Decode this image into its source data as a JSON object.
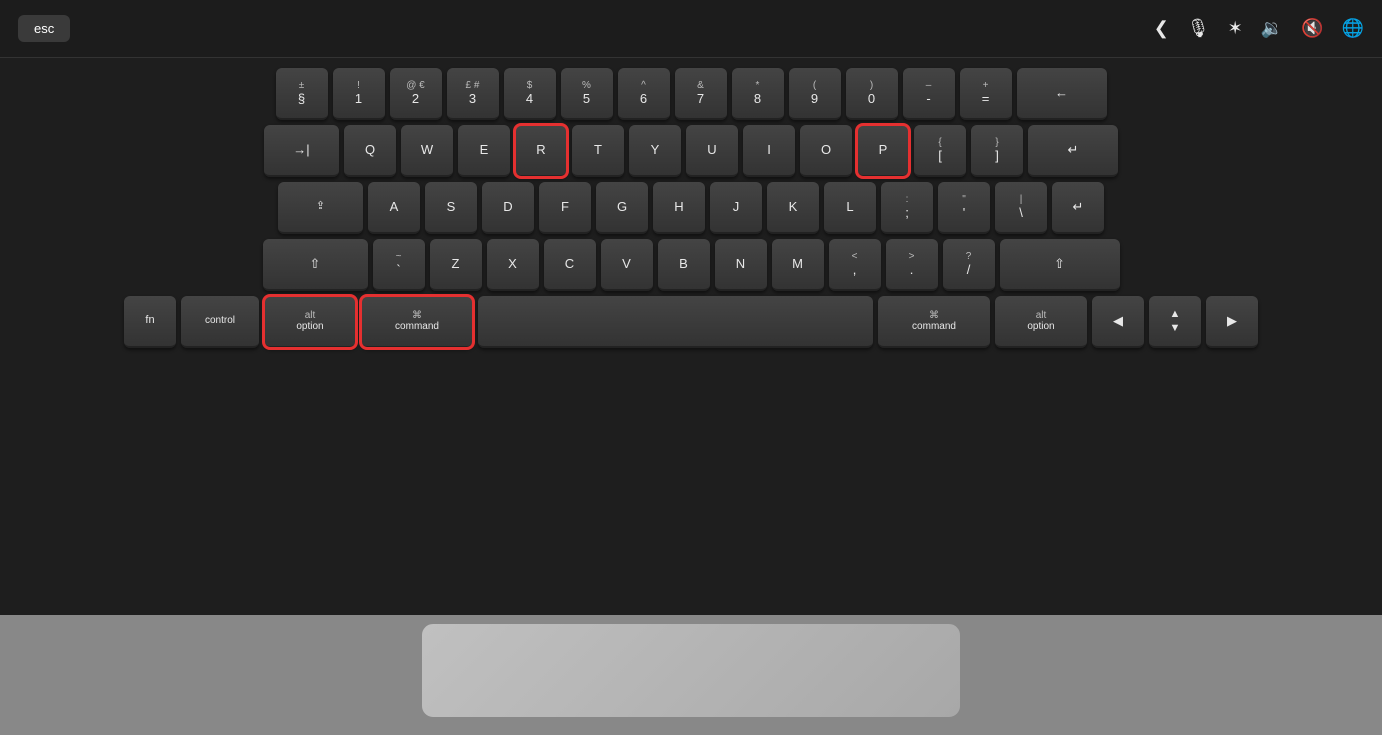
{
  "keyboard": {
    "touchbar": {
      "esc_label": "esc",
      "icons": [
        "(",
        "▣",
        "✦",
        "🔊",
        "🔇",
        "🌐"
      ]
    },
    "row_numbers": {
      "keys": [
        {
          "top": "±",
          "main": "§",
          "wide": false
        },
        {
          "top": "!",
          "main": "1"
        },
        {
          "top": "@€",
          "main": "2"
        },
        {
          "top": "£#",
          "main": "3"
        },
        {
          "top": "$",
          "main": "4"
        },
        {
          "top": "%",
          "main": "5"
        },
        {
          "top": "^",
          "main": "6"
        },
        {
          "top": "&",
          "main": "7"
        },
        {
          "top": "*",
          "main": "8"
        },
        {
          "top": "(",
          "main": "9"
        },
        {
          "top": ")",
          "main": "0"
        },
        {
          "top": "–",
          "main": "-"
        },
        {
          "top": "+",
          "main": "="
        },
        {
          "main": "←",
          "wide": "backspace"
        }
      ]
    },
    "row_qwerty": {
      "keys": [
        "Q",
        "W",
        "E",
        "R",
        "T",
        "Y",
        "U",
        "I",
        "O",
        "P"
      ]
    },
    "row_asdf": {
      "keys": [
        "A",
        "S",
        "D",
        "F",
        "G",
        "H",
        "J",
        "K",
        "L"
      ]
    },
    "row_zxcv": {
      "keys": [
        "Z",
        "X",
        "C",
        "V",
        "B",
        "N",
        "M"
      ]
    },
    "highlighted_keys": [
      "R",
      "P",
      "option_left",
      "command_left"
    ]
  },
  "labels": {
    "esc": "esc",
    "tab": "→|",
    "caps": "⇪",
    "shift_left": "⇧",
    "shift_right": "⇧",
    "fn": "fn",
    "control": "control",
    "option_left_top": "alt",
    "option_left_bottom": "option",
    "command_left_top": "⌘",
    "command_left_bottom": "command",
    "command_right_top": "⌘",
    "command_right_bottom": "command",
    "option_right_top": "alt",
    "option_right_bottom": "option",
    "return": "↵",
    "backspace": "←",
    "spacebar": " "
  }
}
